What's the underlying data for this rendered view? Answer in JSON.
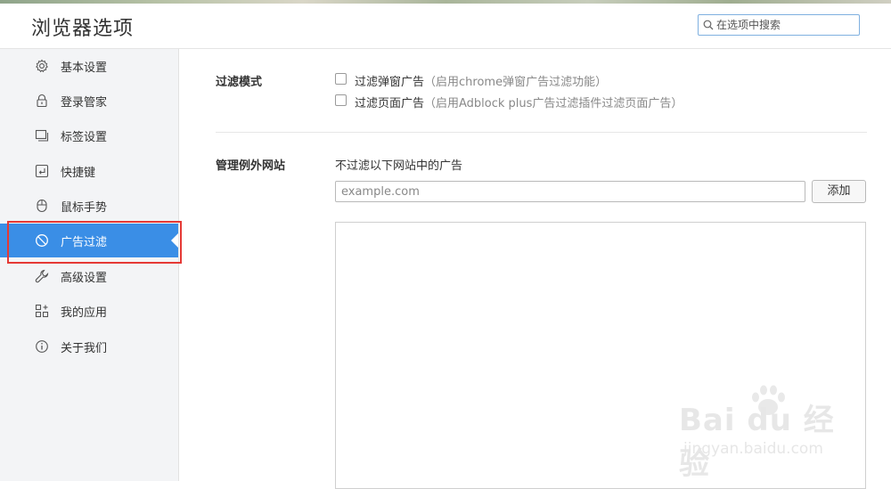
{
  "header": {
    "title": "浏览器选项",
    "search_placeholder": "在选项中搜索"
  },
  "sidebar": {
    "items": [
      {
        "label": "基本设置",
        "icon": "gear-icon"
      },
      {
        "label": "登录管家",
        "icon": "lock-icon"
      },
      {
        "label": "标签设置",
        "icon": "tabs-icon"
      },
      {
        "label": "快捷键",
        "icon": "keyboard-key-icon"
      },
      {
        "label": "鼠标手势",
        "icon": "mouse-icon"
      },
      {
        "label": "广告过滤",
        "icon": "block-icon",
        "active": true
      },
      {
        "label": "高级设置",
        "icon": "wrench-icon"
      },
      {
        "label": "我的应用",
        "icon": "apps-grid-icon"
      },
      {
        "label": "关于我们",
        "icon": "info-icon"
      }
    ]
  },
  "filter": {
    "section_label": "过滤模式",
    "option1_label": "过滤弹窗广告",
    "option1_hint": "（启用chrome弹窗广告过滤功能）",
    "option2_label": "过滤页面广告",
    "option2_hint": "（启用Adblock plus广告过滤插件过滤页面广告）",
    "option1_checked": false,
    "option2_checked": false
  },
  "exceptions": {
    "section_label": "管理例外网站",
    "note": "不过滤以下网站中的广告",
    "input_placeholder": "example.com",
    "add_label": "添加",
    "sites": []
  },
  "watermark": {
    "brand": "Bai du 经验",
    "url": "jingyan.baidu.com"
  },
  "colors": {
    "accent": "#3a8ee6",
    "sidebar_bg": "#f3f4f6",
    "highlight": "#e53935"
  }
}
